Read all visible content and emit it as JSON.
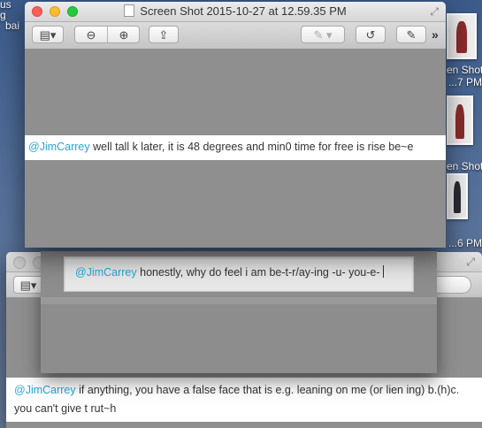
{
  "desktop": {
    "labels": [
      {
        "text": "us"
      },
      {
        "text": "g"
      },
      {
        "text": "bai"
      },
      {
        "text": "en Shot"
      },
      {
        "text": "...7 PM"
      },
      {
        "text": "en Shot"
      },
      {
        "text": "...6 PM"
      }
    ]
  },
  "window_main": {
    "title": "Screen Shot 2015-10-27 at 12.59.35 PM",
    "line": {
      "mention": "@JimCarrey",
      "text": "  well tall k later, it is 48 degrees and min0 time for free is rise be~e"
    }
  },
  "window_middle": {
    "mention": "@JimCarrey",
    "text": " honestly, why do feel i am be-t-r/ay-ing -u- you-e-"
  },
  "window_back": {
    "line1_mention": "@JimCarrey",
    "line1_text": " if anything, you have a false face that is e.g. leaning on me (or lien ing) b.(h)c.",
    "line2_text": "you can't give t rut~h"
  },
  "colors": {
    "mention": "#2aa6d8",
    "content_gray": "#8f8f8f"
  },
  "icons": [
    "sidebar-icon",
    "zoom-out-icon",
    "zoom-in-icon",
    "share-icon",
    "markup-pen-icon",
    "rotate-icon",
    "edit-icon",
    "overflow-chevrons-icon",
    "fullscreen-icon"
  ]
}
